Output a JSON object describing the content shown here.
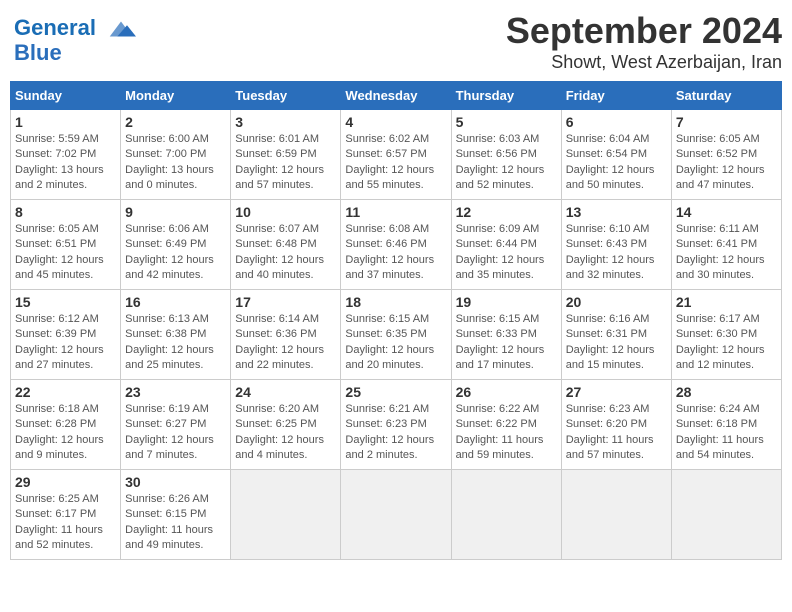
{
  "header": {
    "logo_text_general": "General",
    "logo_text_blue": "Blue",
    "month": "September 2024",
    "location": "Showt, West Azerbaijan, Iran"
  },
  "weekdays": [
    "Sunday",
    "Monday",
    "Tuesday",
    "Wednesday",
    "Thursday",
    "Friday",
    "Saturday"
  ],
  "weeks": [
    [
      {
        "day": "1",
        "info": "Sunrise: 5:59 AM\nSunset: 7:02 PM\nDaylight: 13 hours\nand 2 minutes."
      },
      {
        "day": "2",
        "info": "Sunrise: 6:00 AM\nSunset: 7:00 PM\nDaylight: 13 hours\nand 0 minutes."
      },
      {
        "day": "3",
        "info": "Sunrise: 6:01 AM\nSunset: 6:59 PM\nDaylight: 12 hours\nand 57 minutes."
      },
      {
        "day": "4",
        "info": "Sunrise: 6:02 AM\nSunset: 6:57 PM\nDaylight: 12 hours\nand 55 minutes."
      },
      {
        "day": "5",
        "info": "Sunrise: 6:03 AM\nSunset: 6:56 PM\nDaylight: 12 hours\nand 52 minutes."
      },
      {
        "day": "6",
        "info": "Sunrise: 6:04 AM\nSunset: 6:54 PM\nDaylight: 12 hours\nand 50 minutes."
      },
      {
        "day": "7",
        "info": "Sunrise: 6:05 AM\nSunset: 6:52 PM\nDaylight: 12 hours\nand 47 minutes."
      }
    ],
    [
      {
        "day": "8",
        "info": "Sunrise: 6:05 AM\nSunset: 6:51 PM\nDaylight: 12 hours\nand 45 minutes."
      },
      {
        "day": "9",
        "info": "Sunrise: 6:06 AM\nSunset: 6:49 PM\nDaylight: 12 hours\nand 42 minutes."
      },
      {
        "day": "10",
        "info": "Sunrise: 6:07 AM\nSunset: 6:48 PM\nDaylight: 12 hours\nand 40 minutes."
      },
      {
        "day": "11",
        "info": "Sunrise: 6:08 AM\nSunset: 6:46 PM\nDaylight: 12 hours\nand 37 minutes."
      },
      {
        "day": "12",
        "info": "Sunrise: 6:09 AM\nSunset: 6:44 PM\nDaylight: 12 hours\nand 35 minutes."
      },
      {
        "day": "13",
        "info": "Sunrise: 6:10 AM\nSunset: 6:43 PM\nDaylight: 12 hours\nand 32 minutes."
      },
      {
        "day": "14",
        "info": "Sunrise: 6:11 AM\nSunset: 6:41 PM\nDaylight: 12 hours\nand 30 minutes."
      }
    ],
    [
      {
        "day": "15",
        "info": "Sunrise: 6:12 AM\nSunset: 6:39 PM\nDaylight: 12 hours\nand 27 minutes."
      },
      {
        "day": "16",
        "info": "Sunrise: 6:13 AM\nSunset: 6:38 PM\nDaylight: 12 hours\nand 25 minutes."
      },
      {
        "day": "17",
        "info": "Sunrise: 6:14 AM\nSunset: 6:36 PM\nDaylight: 12 hours\nand 22 minutes."
      },
      {
        "day": "18",
        "info": "Sunrise: 6:15 AM\nSunset: 6:35 PM\nDaylight: 12 hours\nand 20 minutes."
      },
      {
        "day": "19",
        "info": "Sunrise: 6:15 AM\nSunset: 6:33 PM\nDaylight: 12 hours\nand 17 minutes."
      },
      {
        "day": "20",
        "info": "Sunrise: 6:16 AM\nSunset: 6:31 PM\nDaylight: 12 hours\nand 15 minutes."
      },
      {
        "day": "21",
        "info": "Sunrise: 6:17 AM\nSunset: 6:30 PM\nDaylight: 12 hours\nand 12 minutes."
      }
    ],
    [
      {
        "day": "22",
        "info": "Sunrise: 6:18 AM\nSunset: 6:28 PM\nDaylight: 12 hours\nand 9 minutes."
      },
      {
        "day": "23",
        "info": "Sunrise: 6:19 AM\nSunset: 6:27 PM\nDaylight: 12 hours\nand 7 minutes."
      },
      {
        "day": "24",
        "info": "Sunrise: 6:20 AM\nSunset: 6:25 PM\nDaylight: 12 hours\nand 4 minutes."
      },
      {
        "day": "25",
        "info": "Sunrise: 6:21 AM\nSunset: 6:23 PM\nDaylight: 12 hours\nand 2 minutes."
      },
      {
        "day": "26",
        "info": "Sunrise: 6:22 AM\nSunset: 6:22 PM\nDaylight: 11 hours\nand 59 minutes."
      },
      {
        "day": "27",
        "info": "Sunrise: 6:23 AM\nSunset: 6:20 PM\nDaylight: 11 hours\nand 57 minutes."
      },
      {
        "day": "28",
        "info": "Sunrise: 6:24 AM\nSunset: 6:18 PM\nDaylight: 11 hours\nand 54 minutes."
      }
    ],
    [
      {
        "day": "29",
        "info": "Sunrise: 6:25 AM\nSunset: 6:17 PM\nDaylight: 11 hours\nand 52 minutes."
      },
      {
        "day": "30",
        "info": "Sunrise: 6:26 AM\nSunset: 6:15 PM\nDaylight: 11 hours\nand 49 minutes."
      },
      {
        "day": "",
        "info": ""
      },
      {
        "day": "",
        "info": ""
      },
      {
        "day": "",
        "info": ""
      },
      {
        "day": "",
        "info": ""
      },
      {
        "day": "",
        "info": ""
      }
    ]
  ]
}
